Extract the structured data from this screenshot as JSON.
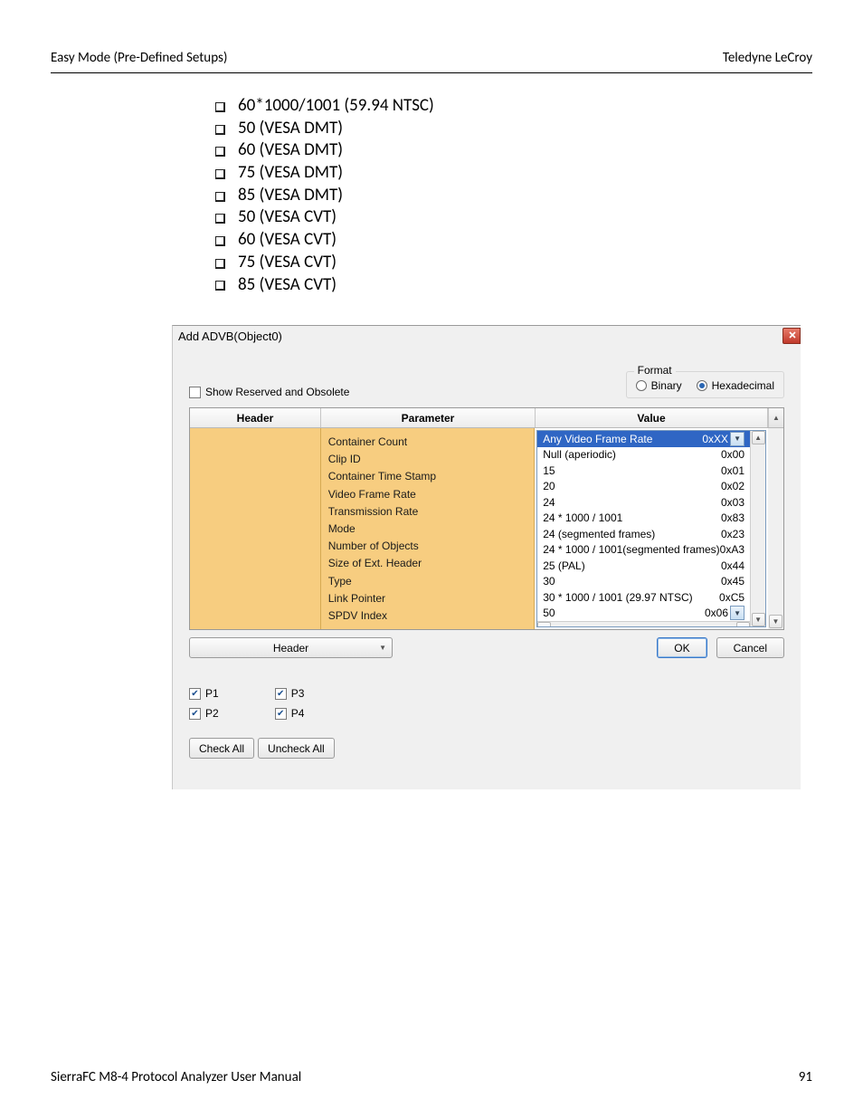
{
  "header": {
    "left": "Easy Mode (Pre-Defined Setups)",
    "right": "Teledyne  LeCroy"
  },
  "bullets": [
    "60*1000/1001 (59.94 NTSC)",
    "50 (VESA DMT)",
    "60 (VESA DMT)",
    "75 (VESA DMT)",
    "85 (VESA DMT)",
    "50 (VESA CVT)",
    "60 (VESA CVT)",
    "75 (VESA CVT)",
    "85 (VESA CVT)"
  ],
  "dialog": {
    "title": "Add ADVB(Object0)",
    "show_reserved": "Show Reserved and Obsolete",
    "format": {
      "legend": "Format",
      "binary": "Binary",
      "hex": "Hexadecimal"
    },
    "columns": {
      "header": "Header",
      "parameter": "Parameter",
      "value": "Value"
    },
    "parameters": [
      "Container Count",
      "Clip ID",
      "Container Time Stamp",
      "Video Frame Rate",
      "Transmission Rate",
      "Mode",
      "Number of Objects",
      "Size of Ext. Header",
      "Type",
      "Link Pointer",
      "SPDV Index"
    ],
    "values": [
      {
        "label": "Any Video Frame Rate",
        "hex": "0xXX",
        "selected": true
      },
      {
        "label": "Null (aperiodic)",
        "hex": "0x00"
      },
      {
        "label": "15",
        "hex": "0x01"
      },
      {
        "label": "20",
        "hex": "0x02"
      },
      {
        "label": "24",
        "hex": "0x03"
      },
      {
        "label": "24 * 1000 / 1001",
        "hex": "0x83"
      },
      {
        "label": "24 (segmented frames)",
        "hex": "0x23"
      },
      {
        "label": "24 * 1000 / 1001(segmented frames)",
        "hex": "0xA3"
      },
      {
        "label": "25 (PAL)",
        "hex": "0x44"
      },
      {
        "label": "30",
        "hex": "0x45"
      },
      {
        "label": "30 * 1000 / 1001 (29.97 NTSC)",
        "hex": "0xC5"
      },
      {
        "label": "50",
        "hex": "0x06"
      }
    ],
    "header_dd": "Header",
    "ok": "OK",
    "cancel": "Cancel",
    "ports": {
      "p1": "P1",
      "p2": "P2",
      "p3": "P3",
      "p4": "P4"
    },
    "check_all": "Check All",
    "uncheck_all": "Uncheck All"
  },
  "footer": {
    "left": "SierraFC M8-4 Protocol Analyzer User Manual",
    "right": "91"
  }
}
